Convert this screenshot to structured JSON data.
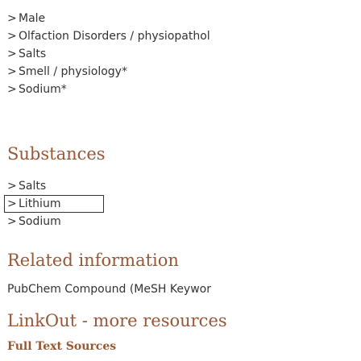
{
  "mesh_terms": {
    "items": [
      {
        "label": "Male"
      },
      {
        "label": "Olfaction Disorders / physiopathol"
      },
      {
        "label": "Salts"
      },
      {
        "label": "Smell / physiology*"
      },
      {
        "label": "Sodium*"
      }
    ]
  },
  "substances": {
    "title": "Substances",
    "items": [
      {
        "label": "Salts"
      },
      {
        "label": "Lithium"
      },
      {
        "label": "Sodium"
      }
    ]
  },
  "related_information": {
    "title": "Related information",
    "link": "PubChem Compound (MeSH Keywor"
  },
  "linkout": {
    "title": "LinkOut - more resources",
    "subheading": "Full Text Sources"
  },
  "colors": {
    "heading": "#985735",
    "text": "#333333"
  },
  "icons": {
    "expand": "chevron-right-icon"
  },
  "chevron_glyph": ">"
}
